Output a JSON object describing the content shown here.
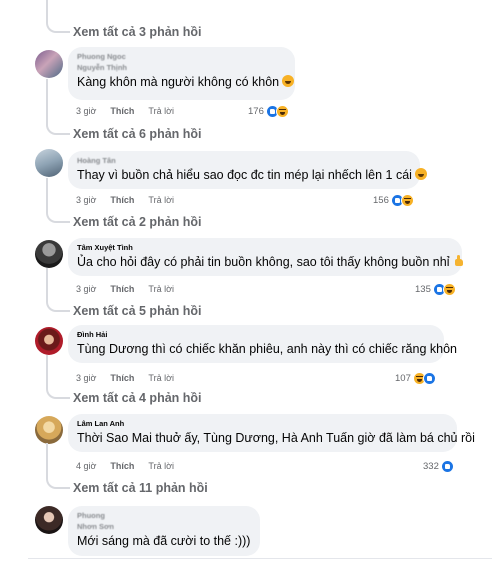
{
  "comments": [
    {
      "author_line1": "Phuong Ngoc",
      "author_line2": "Nguyễn Thịnh",
      "text": "Kàng khôn mà người không có khôn",
      "time": "3 giờ",
      "like_label": "Thích",
      "reply_label": "Trả lời",
      "reaction_count": "176",
      "reactions": [
        "like-icon",
        "haha-icon"
      ],
      "replies_link": "Xem tất cả 6 phản hồi",
      "trailing_emoji": "laughing-emoji-icon"
    },
    {
      "author_line1": "Hoàng Tân",
      "text": "Thay vì buồn chả hiểu sao đọc đc tin mép lại nhếch lên 1 cái",
      "time": "3 giờ",
      "like_label": "Thích",
      "reply_label": "Trả lời",
      "reaction_count": "156",
      "reactions": [
        "like-icon",
        "haha-icon"
      ],
      "replies_link": "Xem tất cả 2 phản hồi",
      "trailing_emoji": "laughing-emoji-icon"
    },
    {
      "author_line1": "Tâm Xuyệt Tình",
      "text": "Ủa cho hỏi đây có phải tin buồn không, sao tôi thấy không buồn nhỉ",
      "time": "3 giờ",
      "like_label": "Thích",
      "reply_label": "Trả lời",
      "reaction_count": "135",
      "reactions": [
        "like-icon",
        "haha-icon"
      ],
      "replies_link": "Xem tất cả 5 phản hồi",
      "trailing_emoji": "thumbs-up-emoji-icon"
    },
    {
      "author_line1": "Đình Hải",
      "text": "Tùng Dương thì có chiếc khăn phiêu, anh này thì có chiếc răng khôn",
      "time": "3 giờ",
      "like_label": "Thích",
      "reply_label": "Trả lời",
      "reaction_count": "107",
      "reactions": [
        "haha-icon",
        "like-icon"
      ],
      "replies_link": "Xem tất cả 4 phản hồi"
    },
    {
      "author_line1": "Lâm Lan Anh",
      "text": "Thời Sao Mai thuở ấy, Tùng Dương, Hà Anh Tuấn giờ đã làm bá chủ rồi",
      "time": "4 giờ",
      "like_label": "Thích",
      "reply_label": "Trả lời",
      "reaction_count": "332",
      "reactions": [
        "like-icon"
      ],
      "replies_link": "Xem tất cả 11 phản hồi"
    },
    {
      "author_line1": "Phuong",
      "author_line2": "Nhơn Sơn",
      "text": "Mới sáng mà đã cười to thế :)))"
    }
  ],
  "top_replies_link": "Xem tất cả 3 phản hồi",
  "colors": {
    "bubble": "#f0f2f5",
    "muted_text": "#65676b",
    "like_blue": "#1b74e4",
    "haha_yellow": "#f7b125"
  }
}
